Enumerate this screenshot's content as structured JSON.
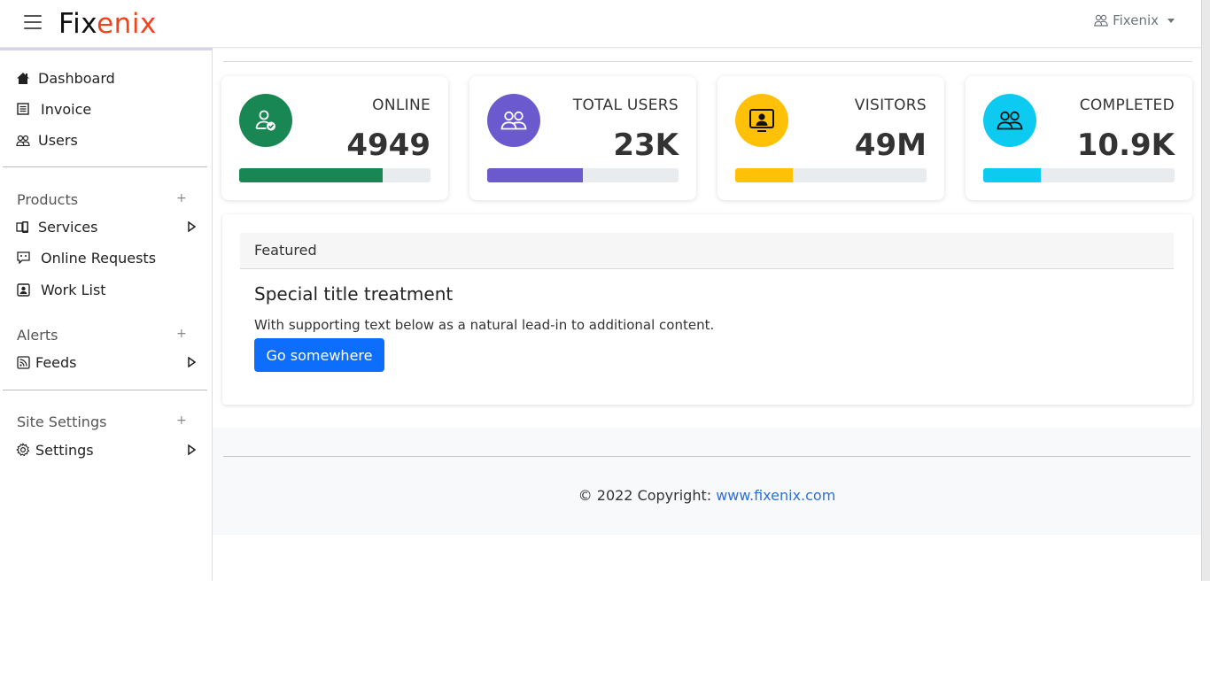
{
  "header": {
    "logo_part1": "Fix",
    "logo_part2": "enix",
    "user_name": "Fixenix",
    "logo_accent_color": "#f0441c"
  },
  "sidebar": {
    "main_items": [
      {
        "label": "Dashboard",
        "icon": "home-icon"
      },
      {
        "label": "Invoice",
        "icon": "document-list-icon"
      },
      {
        "label": "Users",
        "icon": "users-icon"
      }
    ],
    "sections": [
      {
        "title": "Products",
        "items": [
          {
            "label": "Services",
            "icon": "devices-icon",
            "has_arrow": true
          },
          {
            "label": "Online Requests",
            "icon": "chat-icon",
            "has_arrow": false
          },
          {
            "label": "Work List",
            "icon": "person-badge-icon",
            "has_arrow": false
          }
        ]
      },
      {
        "title": "Alerts",
        "items": [
          {
            "label": "Feeds",
            "icon": "rss-icon",
            "has_arrow": true
          }
        ]
      },
      {
        "title": "Site Settings",
        "items": [
          {
            "label": "Settings",
            "icon": "gear-icon",
            "has_arrow": true
          }
        ]
      }
    ],
    "plus_symbol": "+"
  },
  "stats": [
    {
      "label": "ONLINE",
      "value": "4949",
      "color": "#198754",
      "progress": 0.75,
      "icon": "user-check-icon"
    },
    {
      "label": "TOTAL USERS",
      "value": "23K",
      "color": "#6a5acd",
      "progress": 0.5,
      "icon": "users-icon"
    },
    {
      "label": "VISITORS",
      "value": "49M",
      "color": "#ffc107",
      "progress": 0.3,
      "icon": "person-screen-icon"
    },
    {
      "label": "COMPLETED",
      "value": "10.9K",
      "color": "#0dcaf0",
      "progress": 0.3,
      "icon": "users-icon"
    }
  ],
  "featured": {
    "header": "Featured",
    "title": "Special title treatment",
    "text": "With supporting text below as a natural lead-in to additional content.",
    "button_label": "Go somewhere",
    "button_color": "#0d6efd"
  },
  "footer": {
    "copyright": "© 2022 Copyright: ",
    "link_text": "www.fixenix.com"
  }
}
